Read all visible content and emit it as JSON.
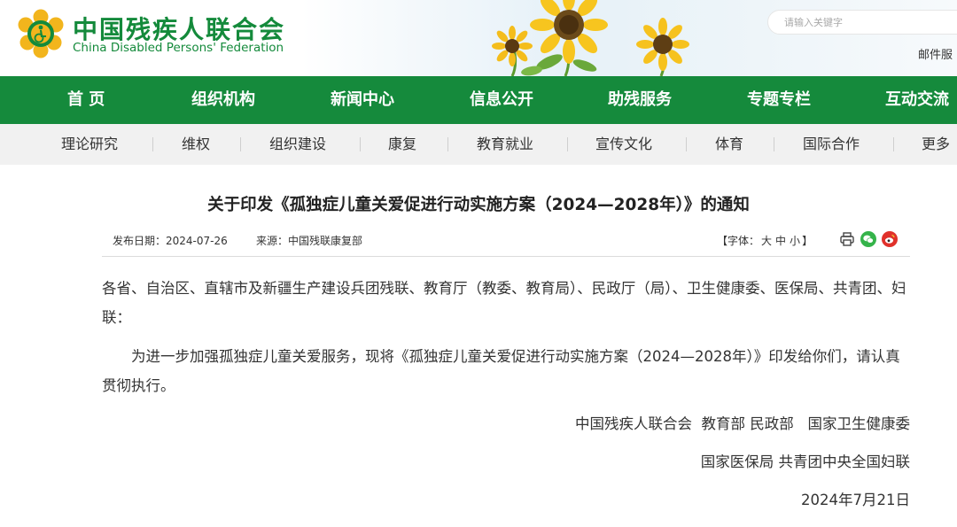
{
  "header": {
    "site_name_cn": "中国残疾人联合会",
    "site_name_en": "China Disabled Persons' Federation",
    "search_placeholder": "请输入关键字",
    "mail_link": "邮件服",
    "brand_color": "#158a3c"
  },
  "main_nav": {
    "items": [
      "首 页",
      "组织机构",
      "新闻中心",
      "信息公开",
      "助残服务",
      "专题专栏",
      "互动交流"
    ]
  },
  "sub_nav": {
    "items": [
      "理论研究",
      "维权",
      "组织建设",
      "康复",
      "教育就业",
      "宣传文化",
      "体育",
      "国际合作",
      "更多"
    ]
  },
  "article": {
    "title": "关于印发《孤独症儿童关爱促进行动实施方案（2024—2028年）》的通知",
    "publish_date_label": "发布日期：",
    "publish_date": "2024-07-26",
    "source_label": "来源：",
    "source": "中国残联康复部",
    "font_size_label": "【字体：",
    "font_size_options": [
      "大",
      "中",
      "小"
    ],
    "font_size_close": "】",
    "share_icons": [
      "print-icon",
      "wechat-icon",
      "weibo-icon"
    ],
    "paragraphs": [
      "各省、自治区、直辖市及新疆生产建设兵团残联、教育厅（教委、教育局）、民政厅（局）、卫生健康委、医保局、共青团、妇联：",
      "为进一步加强孤独症儿童关爱服务，现将《孤独症儿童关爱促进行动实施方案（2024—2028年）》印发给你们，请认真贯彻执行。"
    ],
    "signatures": [
      "中国残疾人联合会  教育部 民政部   国家卫生健康委",
      "国家医保局 共青团中央全国妇联",
      "2024年7月21日"
    ]
  }
}
